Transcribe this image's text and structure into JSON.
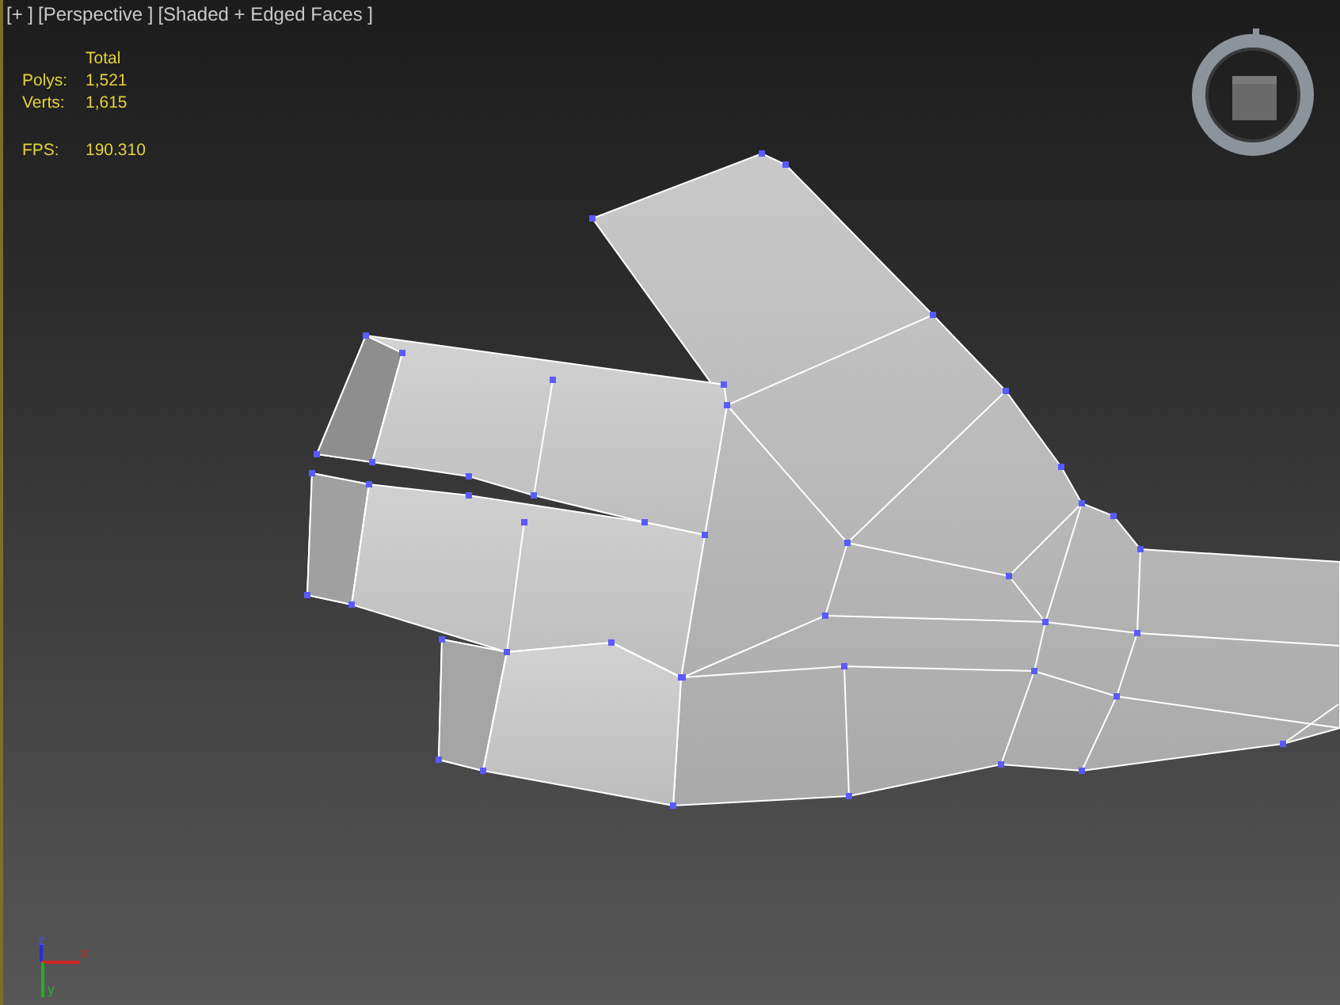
{
  "viewport_labels": [
    "[+ ]",
    "[Perspective ]",
    "[Shaded + Edged Faces ]"
  ],
  "stats": {
    "header": "Total",
    "rows": [
      {
        "label": "Polys:",
        "value": "1,521"
      },
      {
        "label": "Verts:",
        "value": "1,615"
      }
    ],
    "fps": {
      "label": "FPS:",
      "value": "190.310"
    }
  },
  "axis_gizmo": {
    "z": "z",
    "x": "x",
    "y": "y"
  }
}
